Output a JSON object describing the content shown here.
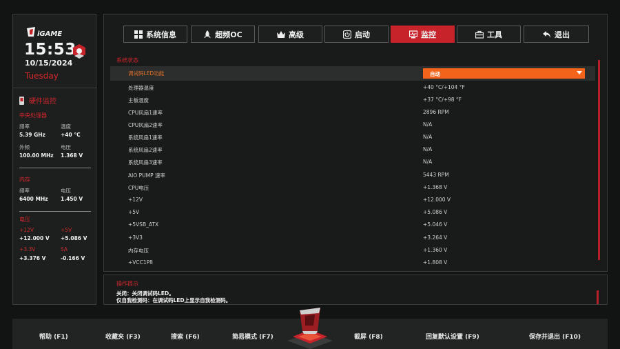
{
  "sidebar": {
    "time": "15:53",
    "date": "10/15/2024",
    "weekday": "Tuesday",
    "hw_monitor_title": "硬件监控",
    "cpu": {
      "title": "中央处理器",
      "freq_label": "频率",
      "freq_value": "5.39 GHz",
      "temp_label": "温度",
      "temp_value": "+40 °C",
      "bclk_label": "外频",
      "bclk_value": "100.00 MHz",
      "volt_label": "电压",
      "volt_value": "1.368 V"
    },
    "memory": {
      "title": "内存",
      "freq_label": "频率",
      "freq_value": "6400 MHz",
      "volt_label": "电压",
      "volt_value": "1.450 V"
    },
    "voltage": {
      "title": "电压",
      "v12_label": "+12V",
      "v12_value": "+12.000 V",
      "v5_label": "+5V",
      "v5_value": "+5.086 V",
      "v33_label": "+3.3V",
      "v33_value": "+3.376 V",
      "sa_label": "SA",
      "sa_value": "-0.166 V"
    }
  },
  "tabs": [
    {
      "label": "系统信息",
      "icon": "grid-icon"
    },
    {
      "label": "超频OC",
      "icon": "rocket-icon"
    },
    {
      "label": "高级",
      "icon": "crown-icon"
    },
    {
      "label": "启动",
      "icon": "power-icon"
    },
    {
      "label": "监控",
      "icon": "monitor-icon",
      "active": true
    },
    {
      "label": "工具",
      "icon": "toolbox-icon"
    },
    {
      "label": "退出",
      "icon": "return-icon"
    }
  ],
  "main": {
    "section_title": "系统状态",
    "led_row": {
      "label": "调试码LED功能",
      "value": "自动"
    },
    "rows": [
      {
        "label": "处理器温度",
        "value": "+40 °C/+104 °F"
      },
      {
        "label": "主板温度",
        "value": "+37 °C/+98 °F"
      },
      {
        "label": "CPU风扇1速率",
        "value": "2896 RPM"
      },
      {
        "label": "CPU风扇2速率",
        "value": "N/A"
      },
      {
        "label": "系统风扇1速率",
        "value": "N/A"
      },
      {
        "label": "系统风扇2速率",
        "value": "N/A"
      },
      {
        "label": "系统风扇3速率",
        "value": "N/A"
      },
      {
        "label": "AIO PUMP 速率",
        "value": "5443 RPM"
      },
      {
        "label": "CPU电压",
        "value": "+1.368 V"
      },
      {
        "label": "+12V",
        "value": "+12.000 V"
      },
      {
        "label": "+5V",
        "value": "+5.086 V"
      },
      {
        "label": "+5VSB_ATX",
        "value": "+5.046 V"
      },
      {
        "label": "+3V3",
        "value": "+3.264 V"
      },
      {
        "label": "内存电压",
        "value": "+1.360 V"
      },
      {
        "label": "+VCC1P8",
        "value": "+1.808 V"
      }
    ]
  },
  "help": {
    "title": "操作提示",
    "line1": "关闭：关闭调试码LED。",
    "line2": "仅自我检测码：在调试码LED上显示自我检测码。"
  },
  "footer": {
    "help": "帮助 (F1)",
    "favorites": "收藏夹 (F3)",
    "search": "搜索 (F6)",
    "easy_mode": "简易模式 (F7)",
    "screenshot": "截屏 (F8)",
    "restore_defaults": "回复默认设置 (F9)",
    "save_exit": "保存并退出 (F10)"
  },
  "colors": {
    "accent_red": "#c6242a",
    "highlight_orange": "#f4631a",
    "background": "#121313"
  }
}
